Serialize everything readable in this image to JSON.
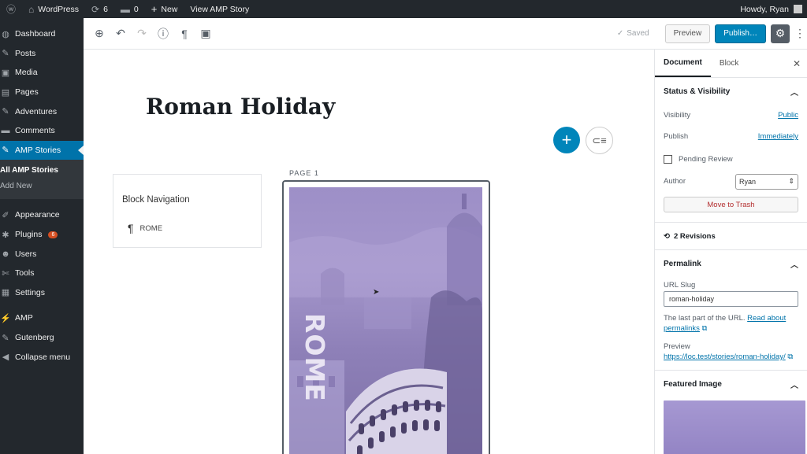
{
  "adminbar": {
    "site_name": "WordPress",
    "updates_count": "6",
    "comments_count": "0",
    "new_label": "New",
    "view_label": "View AMP Story",
    "howdy": "Howdy, Ryan"
  },
  "sidebar": {
    "items": [
      {
        "label": "Dashboard",
        "icon": "dashboard-icon",
        "glyph": "◍"
      },
      {
        "label": "Posts",
        "icon": "pin-icon",
        "glyph": "✎"
      },
      {
        "label": "Media",
        "icon": "media-icon",
        "glyph": "▣"
      },
      {
        "label": "Pages",
        "icon": "page-icon",
        "glyph": "▤"
      },
      {
        "label": "Adventures",
        "icon": "pin-icon",
        "glyph": "✎"
      },
      {
        "label": "Comments",
        "icon": "comment-icon",
        "glyph": "▬"
      },
      {
        "label": "AMP Stories",
        "icon": "pin-icon",
        "glyph": "✎"
      }
    ],
    "submenu": [
      "All AMP Stories",
      "Add New"
    ],
    "items2": [
      {
        "label": "Appearance",
        "icon": "brush-icon",
        "glyph": "✐"
      },
      {
        "label": "Plugins",
        "icon": "plug-icon",
        "glyph": "✱",
        "badge": "6"
      },
      {
        "label": "Users",
        "icon": "user-icon",
        "glyph": "☻"
      },
      {
        "label": "Tools",
        "icon": "wrench-icon",
        "glyph": "✄"
      },
      {
        "label": "Settings",
        "icon": "settings-icon",
        "glyph": "▦"
      }
    ],
    "items3": [
      {
        "label": "AMP",
        "icon": "amp-icon",
        "glyph": "⚡"
      },
      {
        "label": "Gutenberg",
        "icon": "gutenberg-icon",
        "glyph": "✎"
      },
      {
        "label": "Collapse menu",
        "icon": "collapse-icon",
        "glyph": "◀"
      }
    ]
  },
  "toolbar": {
    "saved_label": "Saved",
    "preview_label": "Preview",
    "publish_label": "Publish…"
  },
  "editor": {
    "post_title": "Roman Holiday",
    "block_nav_title": "Block Navigation",
    "block_nav_item": "ROME",
    "page_label": "PAGE 1",
    "story_text": "ROME"
  },
  "settings": {
    "tab_document": "Document",
    "tab_block": "Block",
    "status_title": "Status & Visibility",
    "visibility_label": "Visibility",
    "visibility_value": "Public",
    "publish_label": "Publish",
    "publish_value": "Immediately",
    "pending_label": "Pending Review",
    "author_label": "Author",
    "author_value": "Ryan",
    "trash_label": "Move to Trash",
    "revisions_label": "2 Revisions",
    "permalink_title": "Permalink",
    "url_slug_label": "URL Slug",
    "url_slug_value": "roman-holiday",
    "help_text": "The last part of the URL.",
    "help_link": "Read about permalinks",
    "preview_label": "Preview",
    "preview_url": "https://loc.test/stories/roman-holiday/",
    "featured_title": "Featured Image"
  },
  "colors": {
    "admin_bg": "#23282d",
    "accent": "#0073aa",
    "publish": "#0085ba",
    "story_purple": "#9d8fc7"
  }
}
